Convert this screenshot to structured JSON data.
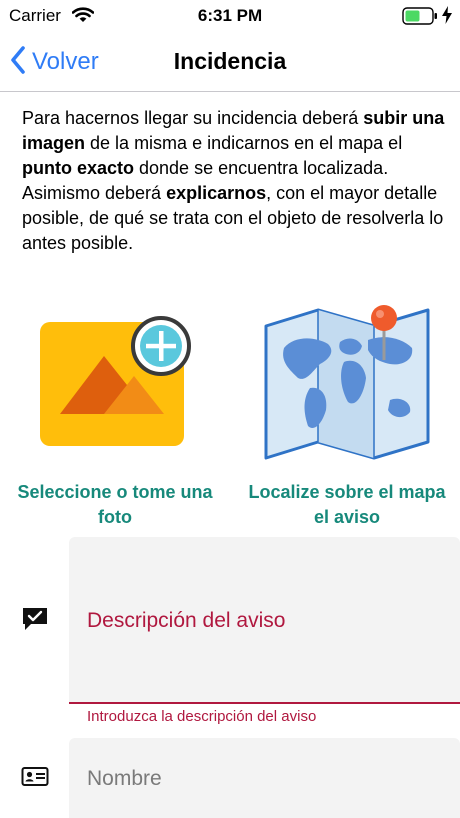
{
  "status_bar": {
    "carrier": "Carrier",
    "time": "6:31 PM",
    "icons": [
      "wifi-icon",
      "battery-icon",
      "charging-bolt-icon"
    ],
    "battery_color": "#4cd964"
  },
  "nav": {
    "back_label": "Volver",
    "title": "Incidencia",
    "accent_color": "#2f7cf6"
  },
  "intro": {
    "p1": "Para hacernos llegar su incidencia deberá ",
    "b1": "subir una imagen",
    "p2": " de la misma e indicarnos en el mapa el ",
    "b2": "punto exacto",
    "p3": " donde se encuentra localizada. Asimismo deberá ",
    "b3": "explicarnos",
    "p4": ", con el mayor detalle posible, de qué se trata con el objeto de resolverla lo antes posible."
  },
  "actions": {
    "photo_label": "Seleccione o tome una foto",
    "map_label": "Localize sobre el mapa el aviso",
    "label_color": "#17897b"
  },
  "form": {
    "description": {
      "placeholder": "Descripción del aviso",
      "helper": "Introduzca la descripción del aviso",
      "error_color": "#b0183f"
    },
    "name": {
      "placeholder": "Nombre"
    }
  }
}
